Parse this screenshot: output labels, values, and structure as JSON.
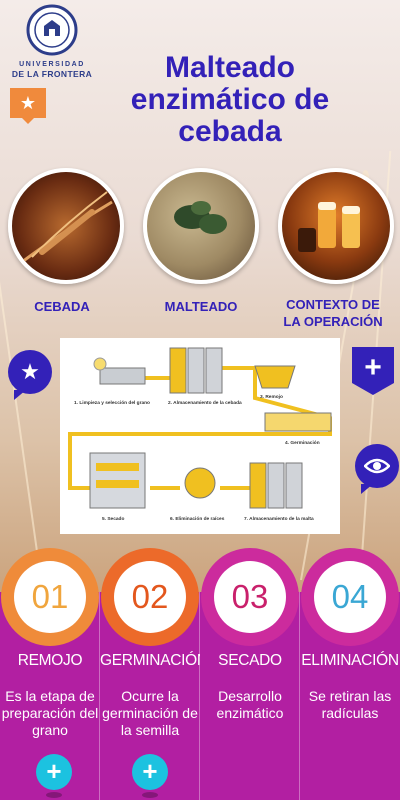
{
  "header": {
    "university_line1": "UNIVERSIDAD",
    "university_line2": "DE LA FRONTERA",
    "title_lines": [
      "Malteado",
      "enzimático de",
      "cebada"
    ]
  },
  "categories": [
    {
      "label": "CEBADA"
    },
    {
      "label": "MALTEADO"
    },
    {
      "label_lines": [
        "CONTEXTO DE",
        "LA OPERACIÓN"
      ]
    }
  ],
  "diagram": {
    "labels": [
      "1. Limpieza y selección del grano",
      "2. Almacenamiento de la cebada",
      "3. Remojo",
      "4. Germinación",
      "5. Secado",
      "6. Eliminación de raíces",
      "7. Almacenamiento de la malta"
    ]
  },
  "steps": [
    {
      "number": "01",
      "title": "REMOJO",
      "description": "Es la etapa de preparación del grano"
    },
    {
      "number": "02",
      "title": "GERMINACIÓN",
      "description": "Ocurre la germinación de la semilla"
    },
    {
      "number": "03",
      "title": "SECADO",
      "description": "Desarrollo enzimático"
    },
    {
      "number": "04",
      "title": "ELIMINACIÓN",
      "description": "Se retiran las radículas"
    }
  ],
  "icons": {
    "small_badge": "star-icon",
    "left_pin": "star-icon",
    "right_shield": "plus-icon",
    "right_pin": "eye-icon",
    "step_buttons": "plus-icon"
  },
  "colors": {
    "title": "#3321b8",
    "panel": "#b21fa2",
    "orange": "#ec6a2a",
    "cyan": "#1cc2e0"
  }
}
